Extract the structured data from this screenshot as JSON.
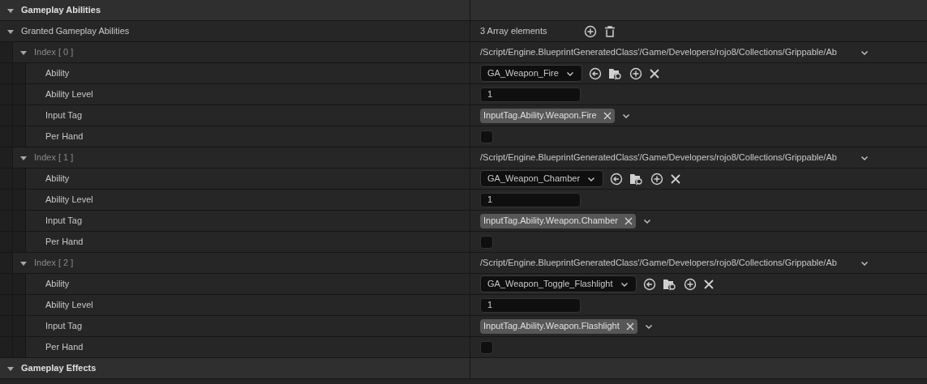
{
  "section": {
    "title": "Gameplay Abilities",
    "expanded": true
  },
  "array": {
    "label": "Granted Gameplay Abilities",
    "expanded": true,
    "count": "3 Array elements",
    "elements": [
      {
        "label": "Index [ 0 ]",
        "expanded": true,
        "class_path": "/Script/Engine.BlueprintGeneratedClass'/Game/Developers/rojo8/Collections/Grippable/Ab",
        "fields": [
          {
            "kind": "asset",
            "label": "Ability",
            "value": "GA_Weapon_Fire"
          },
          {
            "kind": "number",
            "label": "Ability Level",
            "value": "1"
          },
          {
            "kind": "tag",
            "label": "Input Tag",
            "value": "InputTag.Ability.Weapon.Fire"
          },
          {
            "kind": "checkbox",
            "label": "Per Hand",
            "checked": false
          }
        ]
      },
      {
        "label": "Index [ 1 ]",
        "expanded": true,
        "class_path": "/Script/Engine.BlueprintGeneratedClass'/Game/Developers/rojo8/Collections/Grippable/Ab",
        "fields": [
          {
            "kind": "asset",
            "label": "Ability",
            "value": "GA_Weapon_Chamber"
          },
          {
            "kind": "number",
            "label": "Ability Level",
            "value": "1"
          },
          {
            "kind": "tag",
            "label": "Input Tag",
            "value": "InputTag.Ability.Weapon.Chamber"
          },
          {
            "kind": "checkbox",
            "label": "Per Hand",
            "checked": false
          }
        ]
      },
      {
        "label": "Index [ 2 ]",
        "expanded": true,
        "class_path": "/Script/Engine.BlueprintGeneratedClass'/Game/Developers/rojo8/Collections/Grippable/Ab",
        "fields": [
          {
            "kind": "asset",
            "label": "Ability",
            "value": "GA_Weapon_Toggle_Flashlight"
          },
          {
            "kind": "number",
            "label": "Ability Level",
            "value": "1"
          },
          {
            "kind": "tag",
            "label": "Input Tag",
            "value": "InputTag.Ability.Weapon.Flashlight"
          },
          {
            "kind": "checkbox",
            "label": "Per Hand",
            "checked": false
          }
        ]
      }
    ]
  },
  "next_section": {
    "title": "Gameplay Effects",
    "expanded": true
  }
}
